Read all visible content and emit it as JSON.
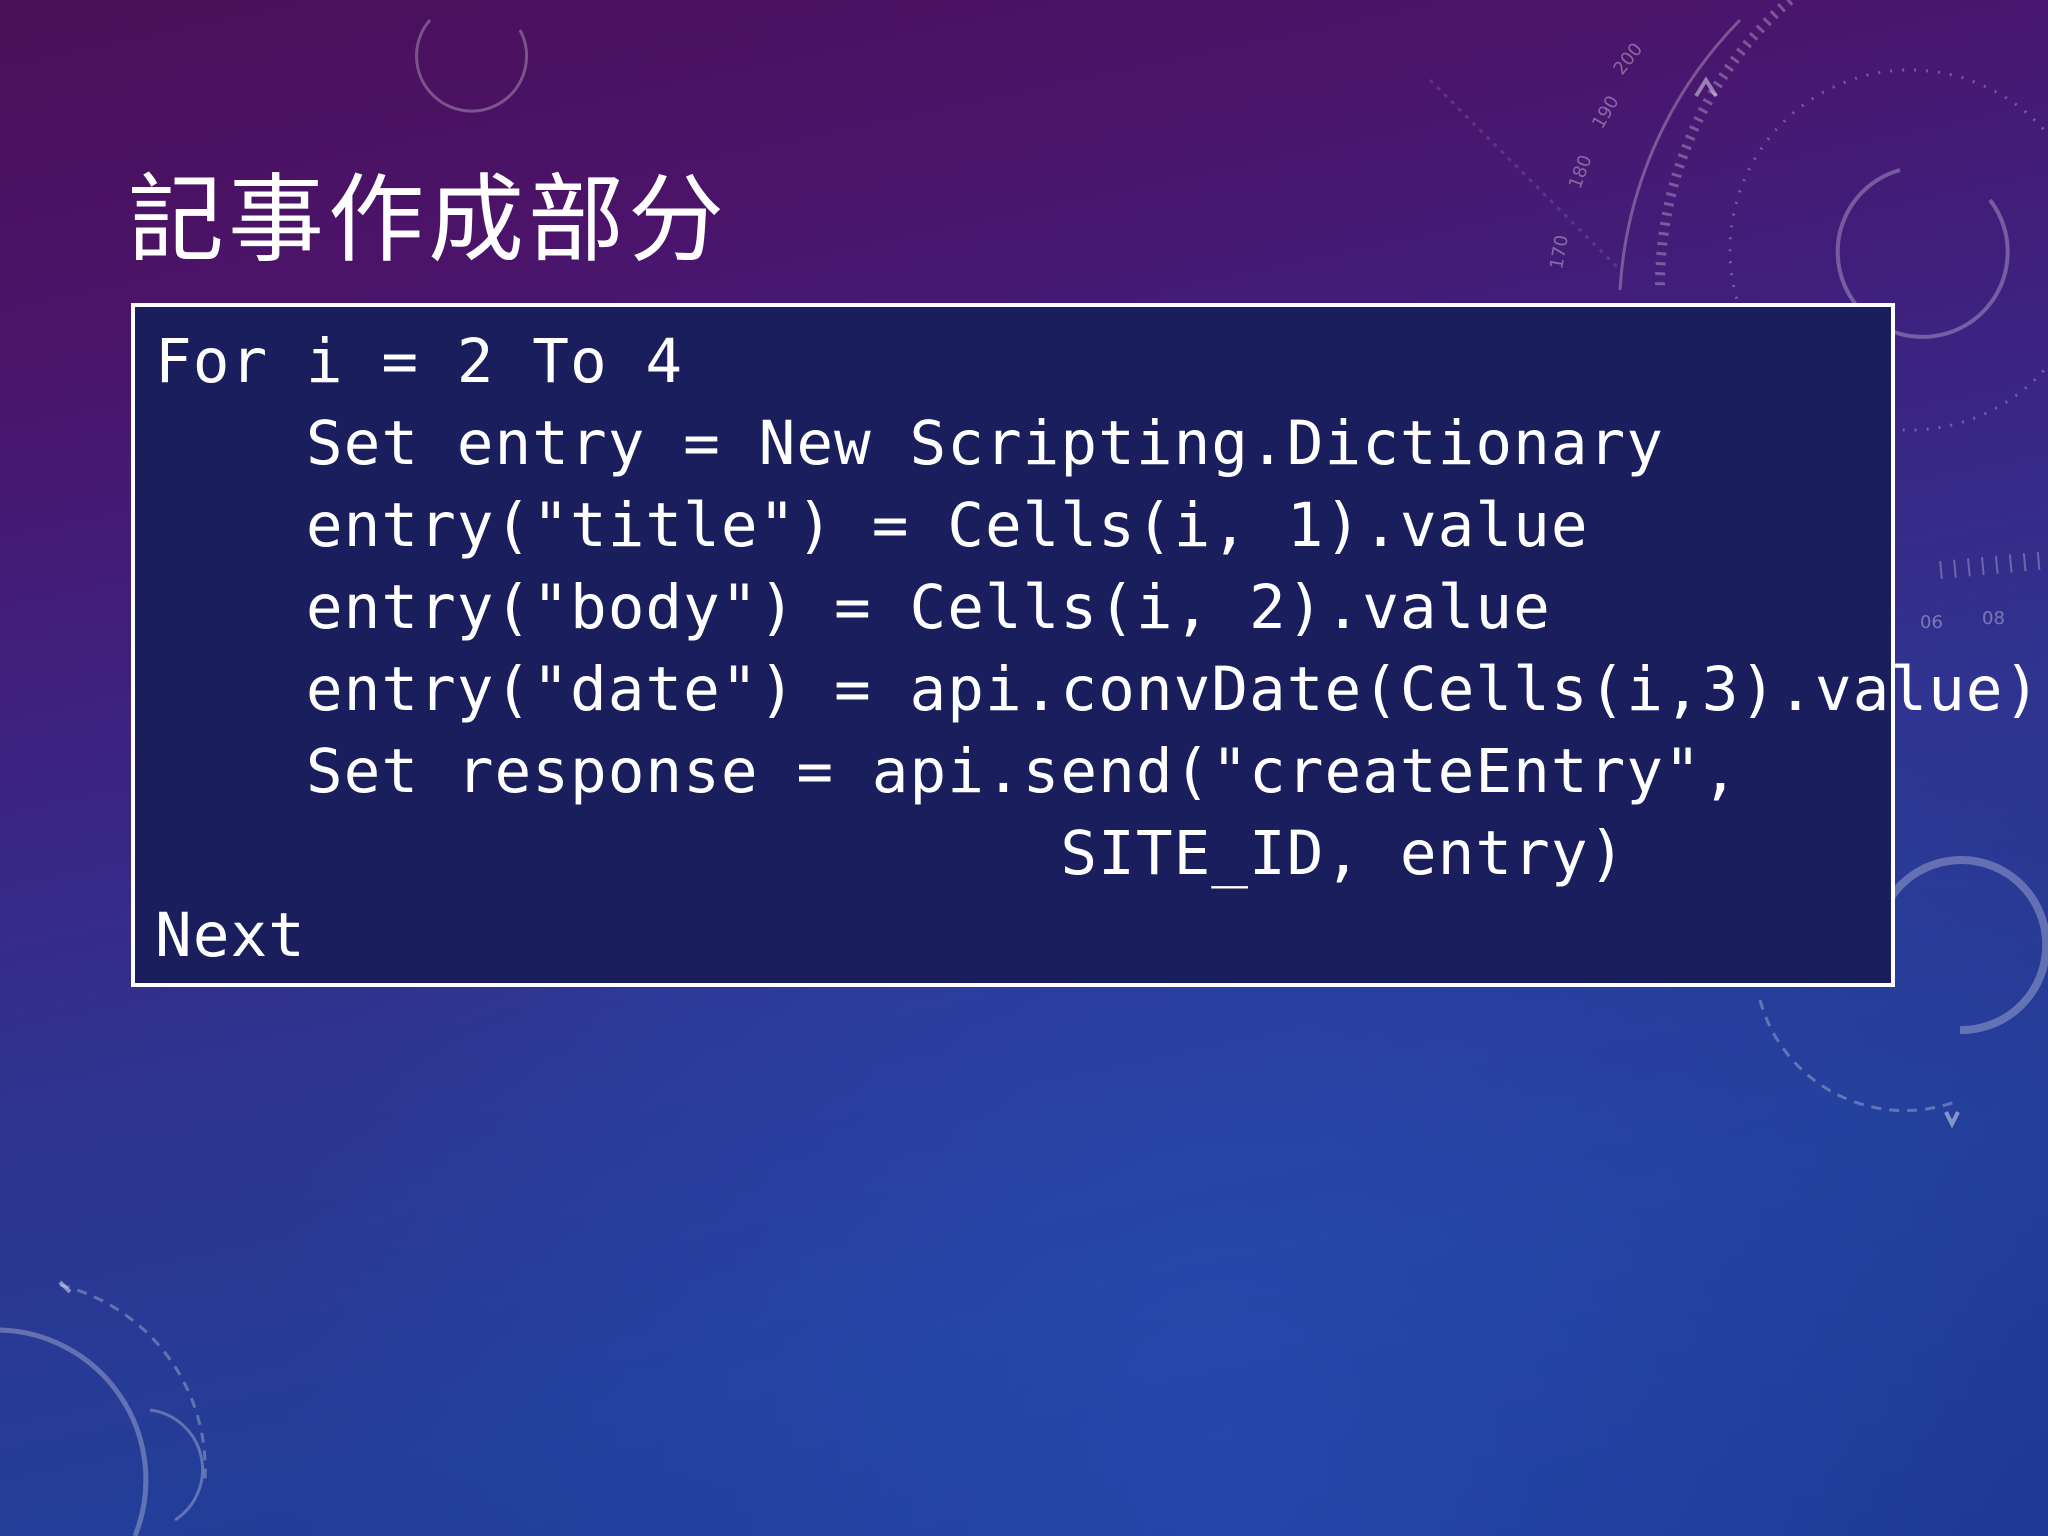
{
  "slide": {
    "title": "記事作成部分",
    "code_lines": [
      "For i = 2 To 4",
      "    Set entry = New Scripting.Dictionary",
      "    entry(\"title\") = Cells(i, 1).value",
      "    entry(\"body\") = Cells(i, 2).value",
      "    entry(\"date\") = api.convDate(Cells(i,3).value)",
      "    Set response = api.send(\"createEntry\",",
      "                        SITE_ID, entry)",
      "Next"
    ]
  },
  "decor": {
    "dial_labels": [
      "170",
      "180",
      "190",
      "200",
      "06",
      "08"
    ]
  },
  "colors": {
    "code_background": "#1a1e5c",
    "code_border": "#ffffff",
    "text": "#ffffff"
  }
}
